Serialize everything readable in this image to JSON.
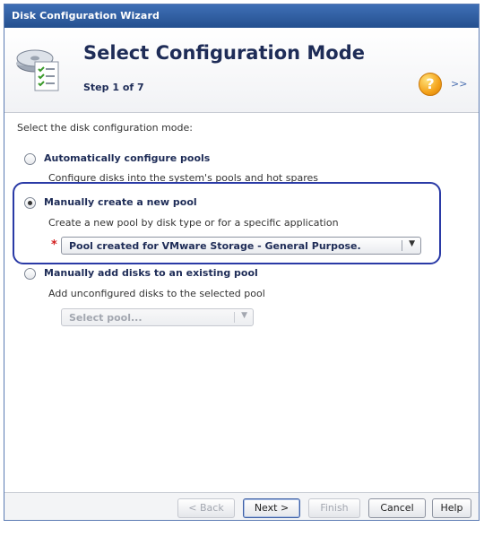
{
  "window": {
    "title": "Disk Configuration Wizard"
  },
  "header": {
    "title": "Select Configuration Mode",
    "step": "Step 1 of 7",
    "help_icon": "help-question-icon",
    "expand_label": ">>"
  },
  "content": {
    "prompt": "Select the disk configuration mode:",
    "options": [
      {
        "label": "Automatically configure pools",
        "description": "Configure disks into the system's pools and hot spares",
        "selected": false
      },
      {
        "label": "Manually create a new pool",
        "description": "Create a new pool by disk type or for a specific application",
        "selected": true
      },
      {
        "label": "Manually add disks to an existing pool",
        "description": "Add unconfigured disks to the selected pool",
        "selected": false
      }
    ],
    "pool_type_select": {
      "value": "Pool created for VMware Storage - General Purpose.",
      "required_marker": "*"
    },
    "existing_pool_select": {
      "value": "Select pool...",
      "enabled": false
    }
  },
  "footer": {
    "back_label": "< Back",
    "next_label": "Next >",
    "finish_label": "Finish",
    "cancel_label": "Cancel",
    "help_label": "Help"
  },
  "colors": {
    "title_bar": "#2d5ea8",
    "accent_text": "#1e2c57",
    "highlight_border": "#2a3aa6",
    "required": "#d32020"
  }
}
